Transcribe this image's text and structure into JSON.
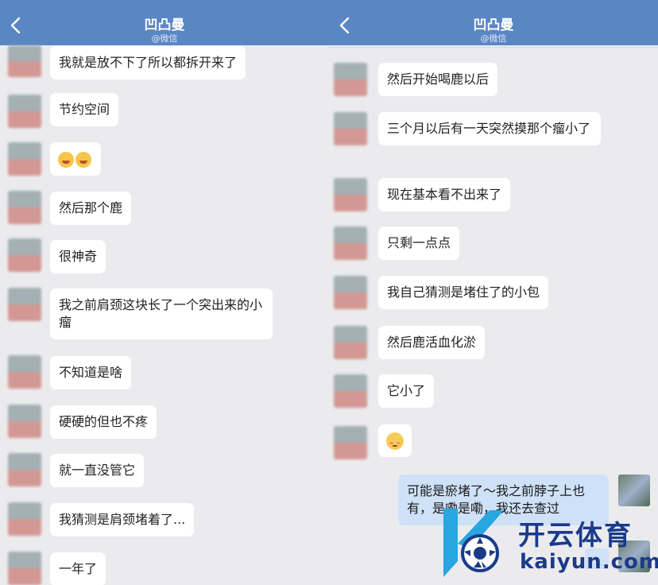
{
  "header": {
    "title": "凹凸曼",
    "subtitle": "@微信"
  },
  "left_messages": [
    "我就是放不下了所以都拆开来了",
    "节约空间",
    "然后那个鹿",
    "很神奇",
    "我之前肩颈这块长了一个突出来的小瘤",
    "不知道是啥",
    "硬硬的但也不疼",
    "就一直没管它",
    "我猜测是肩颈堵着了...",
    "一年了"
  ],
  "left_emoji_message": {
    "icon": "laughing-emoji-icon",
    "count": 2
  },
  "right_messages": [
    "然后开始喝鹿以后",
    "三个月以后有一天突然摸那个瘤小了",
    "现在基本看不出来了",
    "只剩一点点",
    "我自己猜测是堵住了的小包",
    "然后鹿活血化淤",
    "它小了"
  ],
  "right_emoji_message": {
    "icon": "shy-emoji-icon"
  },
  "my_message": "可能是瘀堵了～我之前脖子上也有，是嘞是嘞，我还去查过",
  "watermark": {
    "brand": "开云体育",
    "url": "kaiyun.com",
    "colors": {
      "blue": "#1a3a8a",
      "cyan": "#27a6e0"
    }
  },
  "colors": {
    "header_bg": "#5b86c4",
    "chat_bg": "#ebebee",
    "bubble_in": "#ffffff",
    "bubble_out": "#cfe1f7"
  }
}
